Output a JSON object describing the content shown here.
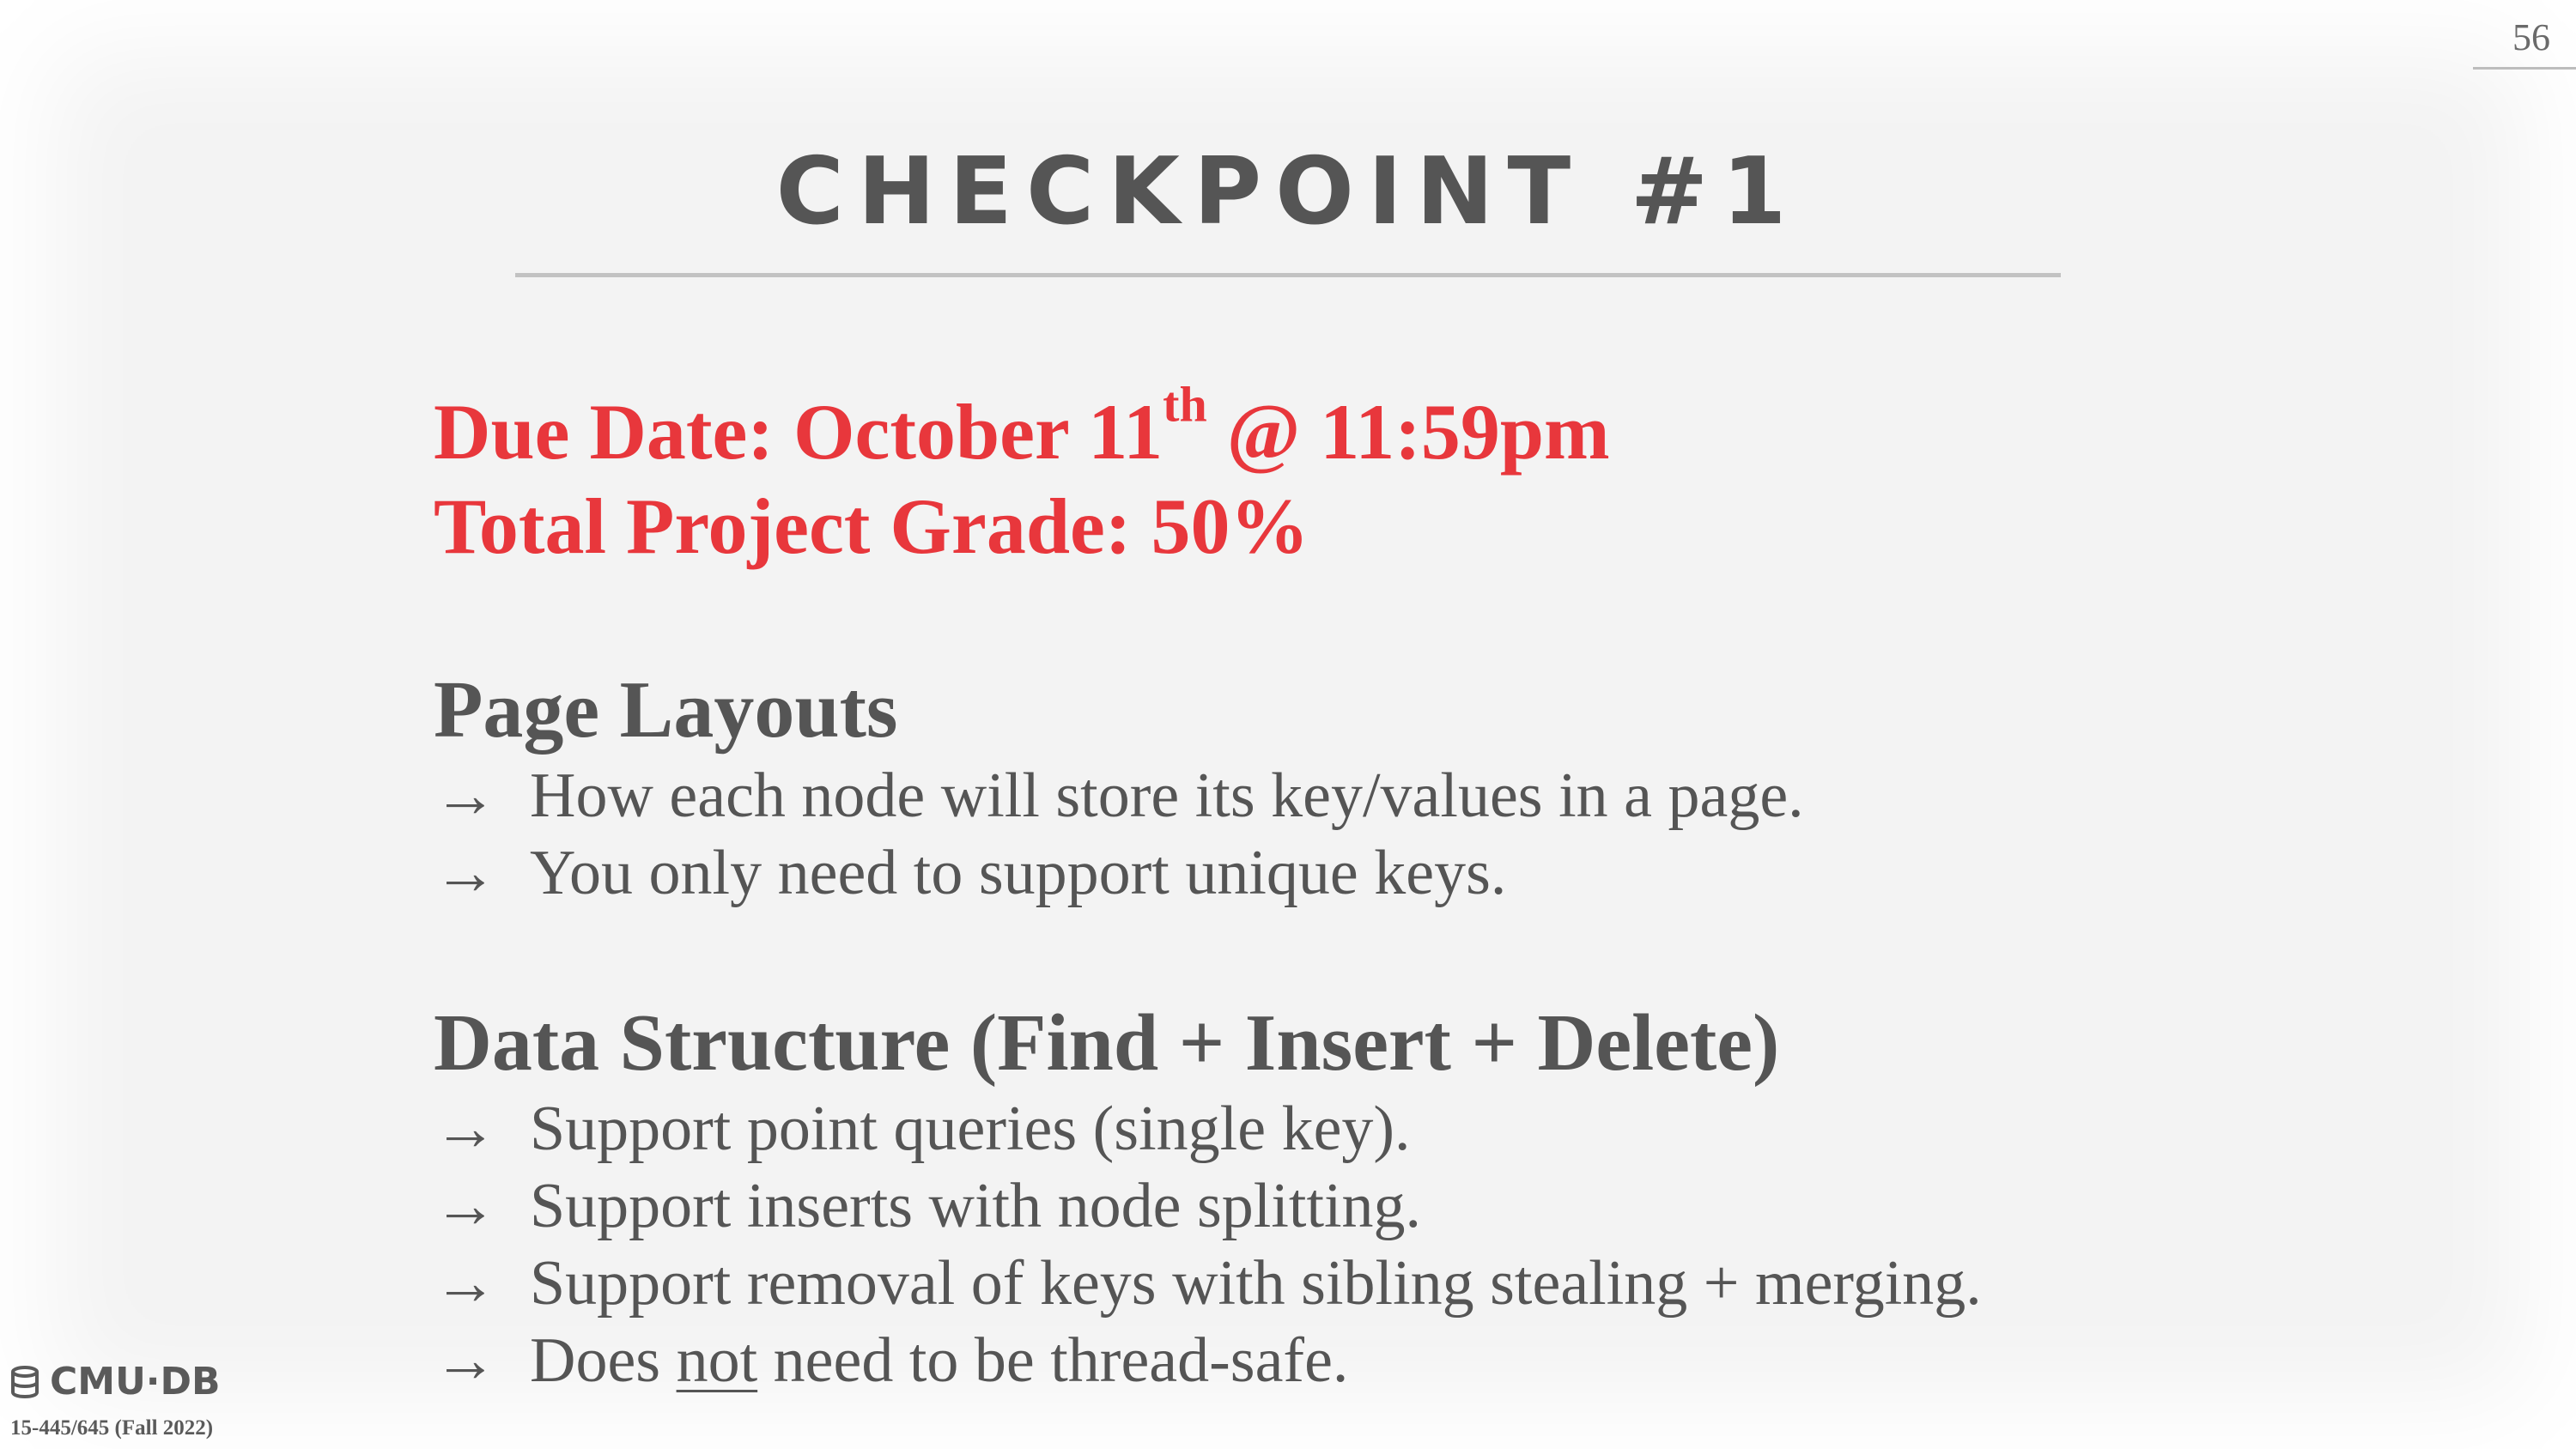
{
  "page_number": "56",
  "title": "CHECKPOINT #1",
  "due": {
    "prefix": "Due Date: October 11",
    "superscript": "th",
    "suffix": " @ 11:59pm"
  },
  "grade": "Total Project Grade: 50%",
  "arrow_glyph": "→",
  "sections": {
    "page_layouts": {
      "heading": "Page Layouts",
      "bullets": [
        "How each node will store its key/values in a page.",
        "You only need to support unique keys."
      ]
    },
    "data_structure": {
      "heading": "Data Structure (Find + Insert + Delete)",
      "bullets": [
        "Support point queries (single key).",
        "Support inserts with node splitting.",
        "Support removal of keys with sibling stealing + merging."
      ],
      "last_bullet": {
        "before": "Does ",
        "underlined": "not",
        "after": " need to be thread-safe."
      }
    }
  },
  "footer": {
    "logo_text": "CMU·DB",
    "course": "15-445/645 (Fall 2022)"
  },
  "colors": {
    "accent_red": "#e8373c",
    "text_gray": "#555555",
    "background": "#f3f3f3"
  }
}
